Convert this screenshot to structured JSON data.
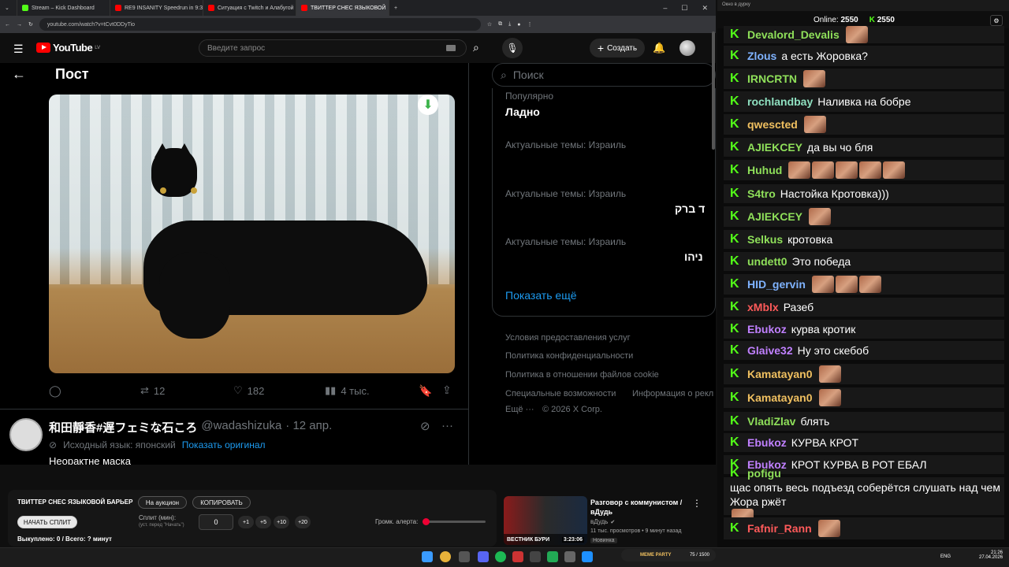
{
  "browser": {
    "tabs": [
      {
        "label": "Stream – Kick Dashboard",
        "color": "#53fc18"
      },
      {
        "label": "RE9 INSANITY Speedrun in 9:3",
        "color": "#ff0000"
      },
      {
        "label": "Ситуация с Twitch и Алабугой",
        "color": "#ff0000"
      },
      {
        "label": "ТВИТТЕР СНЕС ЯЗЫКОВОЙ",
        "color": "#ff0000"
      }
    ],
    "url": "youtube.com/watch?v=tCvt0DDyTio"
  },
  "youtube": {
    "logo": "YouTube",
    "region": "LV",
    "search_placeholder": "Введите запрос",
    "create_label": "Создать"
  },
  "post": {
    "title": "Пост",
    "replies_count": "",
    "retweets": "12",
    "likes": "182",
    "views": "4 тыс.",
    "next_author": "和田靜香#遅フェミな石ころ",
    "next_handle": "@wadashizuka",
    "next_date": "· 12 апр.",
    "lang_note": "Исходный язык: японский",
    "show_original": "Показать оригинал",
    "partial_text": "Неорактне маска"
  },
  "sidebar": {
    "search_placeholder": "Поиск",
    "popular_label": "Популярно",
    "top_trend": "Ладно",
    "trends": [
      {
        "label": "Актуальные темы: Израиль",
        "value": ""
      },
      {
        "label": "Актуальные темы: Израиль",
        "value": "ד ברק"
      },
      {
        "label": "Актуальные темы: Израиль",
        "value": "ניהו"
      }
    ],
    "show_more": "Показать ещё",
    "footer_links": [
      "Условия предоставления услуг",
      "Политика конфиденциальности",
      "Политика в отношении файлов cookie",
      "Специальные возможности",
      "Информация о рекл",
      "Ещё ···",
      "© 2026 X Corp."
    ]
  },
  "widget": {
    "title": "ТВИТТЕР СНЕС ЯЗЫКОВОЙ БАРЬЕР",
    "auction_btn": "На аукцион",
    "copy_btn": "КОПИРОВАТЬ",
    "start_btn": "НАЧАТЬ СПЛИТ",
    "split_label": "Сплит (мин):",
    "split_hint": "(уст. перед \"Начать\")",
    "split_value": "0",
    "increments": [
      "+1",
      "+5",
      "+10",
      "+20"
    ],
    "volume_label": "Громк. алерта:",
    "volume_level": 0.05,
    "status": "Выкуплено: 0 / Всего: ? минут"
  },
  "recommended": {
    "title": "Разговор с коммунистом / вДудь",
    "channel": "вДудь",
    "meta": "11 тыс. просмотров • 9 минут назад",
    "badge": "Новинка",
    "duration": "3:23:06",
    "thumb_text": "ВЕСТНИК БУРИ"
  },
  "chat": {
    "window_title": "Окно в дурку",
    "online_label": "Online:",
    "online_count": "2550",
    "viewers": "2550",
    "messages": [
      {
        "user": "Devalord_Devalis",
        "color": "#8fe05a",
        "text": "",
        "emotes": 1
      },
      {
        "user": "Zlous",
        "color": "#7fb3ff",
        "text": "а есть Жоровка?",
        "emotes": 0
      },
      {
        "user": "IRNCRTN",
        "color": "#8fe05a",
        "text": "",
        "emotes": 1
      },
      {
        "user": "rochlandbay",
        "color": "#8fe0c0",
        "text": "Наливка на бобре",
        "emotes": 0
      },
      {
        "user": "qwescted",
        "color": "#f0c060",
        "text": "",
        "emotes": 1
      },
      {
        "user": "AJIEKCEY",
        "color": "#8fe05a",
        "text": "да вы чо бля",
        "emotes": 0
      },
      {
        "user": "Huhud",
        "color": "#8fe05a",
        "text": "",
        "emotes": 5
      },
      {
        "user": "S4tro",
        "color": "#8fe05a",
        "text": "Настойка Кротовка)))",
        "emotes": 0
      },
      {
        "user": "AJIEKCEY",
        "color": "#8fe05a",
        "text": "",
        "emotes": 1
      },
      {
        "user": "Selkus",
        "color": "#8fe05a",
        "text": "кротовка",
        "emotes": 0
      },
      {
        "user": "undett0",
        "color": "#8fe05a",
        "text": "Это победа",
        "emotes": 0
      },
      {
        "user": "HID_gervin",
        "color": "#7fb3ff",
        "text": "",
        "emotes": 3
      },
      {
        "user": "xMblx",
        "color": "#ff5a5a",
        "text": "Разеб",
        "emotes": 0
      },
      {
        "user": "Ebukoz",
        "color": "#c080ff",
        "text": "курва кротик",
        "emotes": 0
      },
      {
        "user": "Glaive32",
        "color": "#c080ff",
        "text": "Ну это скебоб",
        "emotes": 0
      },
      {
        "user": "Kamatayan0",
        "color": "#f0c060",
        "text": "",
        "emotes": 1
      },
      {
        "user": "Kamatayan0",
        "color": "#f0c060",
        "text": "",
        "emotes": 1
      },
      {
        "user": "VladiZlav",
        "color": "#8fe05a",
        "text": "блять",
        "emotes": 0
      },
      {
        "user": "Ebukoz",
        "color": "#c080ff",
        "text": "КУРВА КРОТ",
        "emotes": 0
      },
      {
        "user": "Ebukoz",
        "color": "#c080ff",
        "text": "КРОТ КУРВА В РОТ ЕБАЛ",
        "emotes": 0
      },
      {
        "user": "pofigu",
        "color": "#8fe05a",
        "text": "щас опять весь подъезд соберётся слушать над чем Жора ржёт",
        "emotes": 1
      },
      {
        "user": "Fafnir_Rann",
        "color": "#ff5a5a",
        "text": "",
        "emotes": 1
      }
    ]
  },
  "taskbar": {
    "lang": "ENG",
    "time": "21:26",
    "date": "27.04.2026",
    "meme_party": "MEME PARTY",
    "meme_progress": "75 / 1500"
  }
}
